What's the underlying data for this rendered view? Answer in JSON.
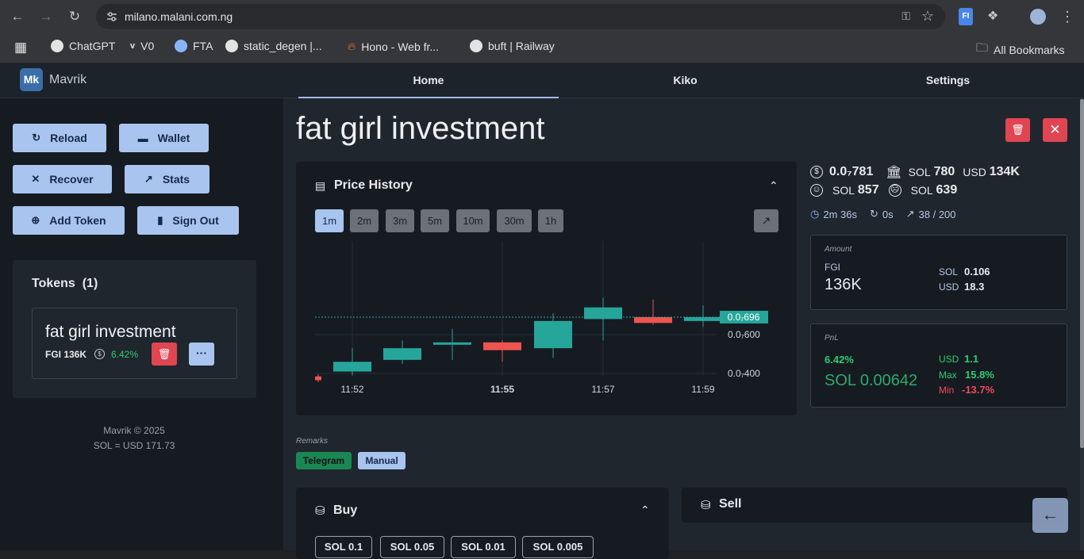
{
  "browser": {
    "url": "milano.malani.com.ng",
    "bookmarks": [
      "ChatGPT",
      "V0",
      "FTA",
      "static_degen |...",
      "Hono - Web fr...",
      "buft | Railway"
    ],
    "all_bookmarks": "All Bookmarks",
    "extension_label": "FI"
  },
  "app": {
    "logo": "Mk",
    "brand": "Mavrik",
    "tabs": [
      "Home",
      "Kiko",
      "Settings"
    ],
    "active_tab": "Home"
  },
  "sidebar": {
    "buttons": {
      "reload": "Reload",
      "wallet": "Wallet",
      "recover": "Recover",
      "stats": "Stats",
      "add_token": "Add Token",
      "sign_out": "Sign Out"
    },
    "tokens_title": "Tokens",
    "tokens_count": "(1)",
    "token": {
      "name": "fat girl investment",
      "symbol_amount": "FGI 136K",
      "pct": "6.42%",
      "more": "···"
    },
    "footer_line1": "Mavrik © 2025",
    "footer_line2": "SOL = USD 171.73"
  },
  "main": {
    "title": "fat girl investment",
    "price_history": {
      "title": "Price History",
      "timeframes": [
        "1m",
        "2m",
        "3m",
        "5m",
        "10m",
        "30m",
        "1h"
      ],
      "active_timeframe": "1m"
    },
    "stats": {
      "price": "0.0₇781",
      "liq_sol_label": "SOL",
      "liq_sol": "780",
      "liq_usd_label": "USD",
      "liq_usd": "134K",
      "happy_sol_label": "SOL",
      "happy_sol": "857",
      "sad_sol_label": "SOL",
      "sad_sol": "639",
      "timer": "2m 36s",
      "refresh": "0s",
      "progress": "38 / 200"
    },
    "amount_panel": {
      "label": "Amount",
      "symbol": "FGI",
      "value": "136K",
      "sol_label": "SOL",
      "sol": "0.106",
      "usd_label": "USD",
      "usd": "18.3"
    },
    "pnl_panel": {
      "label": "PnL",
      "pct": "6.42%",
      "sol_value": "SOL 0.00642",
      "usd_label": "USD",
      "usd": "1.1",
      "max_label": "Max",
      "max": "15.8%",
      "min_label": "Min",
      "min": "-13.7%"
    },
    "remarks_label": "Remarks",
    "remarks": [
      "Telegram",
      "Manual"
    ],
    "buy_title": "Buy",
    "sell_title": "Sell",
    "buy_amounts": [
      "SOL 0.1",
      "SOL 0.05",
      "SOL 0.01",
      "SOL 0.005"
    ]
  },
  "colors": {
    "accent": "#a9c4ee",
    "danger": "#e04552",
    "up": "#26a69a",
    "down": "#ef5350",
    "positive_text": "#2ecc71"
  },
  "chart_data": {
    "type": "candlestick",
    "categories": [
      "11:51",
      "11:52",
      "11:53",
      "11:54",
      "11:55",
      "11:56",
      "11:57",
      "11:58",
      "11:59"
    ],
    "x_tick_labels": [
      "11:52",
      "11:55",
      "11:57",
      "11:59"
    ],
    "y_tick_labels": [
      "0.0₇600",
      "0.0₇400"
    ],
    "ylim": [
      2e-08,
      8e-08
    ],
    "last_price_label": "0.0₇696",
    "series": [
      {
        "open": 3.85e-08,
        "high": 3.95e-08,
        "low": 3.55e-08,
        "close": 3.65e-08
      },
      {
        "open": 4.1e-08,
        "high": 5.3e-08,
        "low": 3.9e-08,
        "close": 4.6e-08
      },
      {
        "open": 4.7e-08,
        "high": 5.7e-08,
        "low": 4.5e-08,
        "close": 5.3e-08
      },
      {
        "open": 5.5e-08,
        "high": 6.3e-08,
        "low": 4.7e-08,
        "close": 5.6e-08
      },
      {
        "open": 5.6e-08,
        "high": 5.7e-08,
        "low": 4.6e-08,
        "close": 5.2e-08
      },
      {
        "open": 5.3e-08,
        "high": 7.1e-08,
        "low": 4.8e-08,
        "close": 6.7e-08
      },
      {
        "open": 6.8e-08,
        "high": 7.9e-08,
        "low": 5.7e-08,
        "close": 7.4e-08
      },
      {
        "open": 6.9e-08,
        "high": 7.8e-08,
        "low": 6.5e-08,
        "close": 6.6e-08
      },
      {
        "open": 6.7e-08,
        "high": 7.5e-08,
        "low": 6.4e-08,
        "close": 6.9e-08
      }
    ]
  }
}
